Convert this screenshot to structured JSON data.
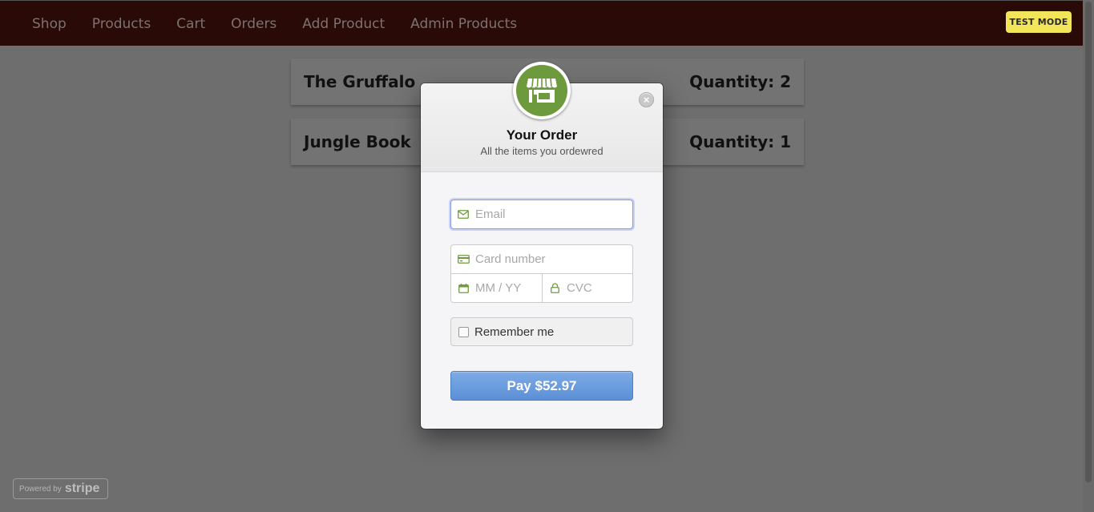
{
  "navbar": {
    "items": [
      {
        "label": "Shop"
      },
      {
        "label": "Products"
      },
      {
        "label": "Cart"
      },
      {
        "label": "Orders"
      },
      {
        "label": "Add Product"
      },
      {
        "label": "Admin Products"
      }
    ],
    "badge": "TEST MODE"
  },
  "orders": [
    {
      "name": "The Gruffalo",
      "quantity": "Quantity: 2"
    },
    {
      "name": "Jungle Book",
      "quantity": "Quantity: 1"
    }
  ],
  "powered_by": {
    "prefix": "Powered by",
    "brand": "stripe"
  },
  "checkout": {
    "title": "Your Order",
    "subtitle": "All the items you ordewred",
    "close_icon": "×",
    "email_placeholder": "Email",
    "card_placeholder": "Card number",
    "expiry_placeholder": "MM / YY",
    "cvc_placeholder": "CVC",
    "remember_label": "Remember me",
    "pay_label": "Pay $52.97"
  },
  "colors": {
    "accent_green": "#6e9a3e",
    "pay_blue": "#5b8fd6",
    "test_mode_yellow": "#f2e55a",
    "navbar": "#2a0a06"
  }
}
